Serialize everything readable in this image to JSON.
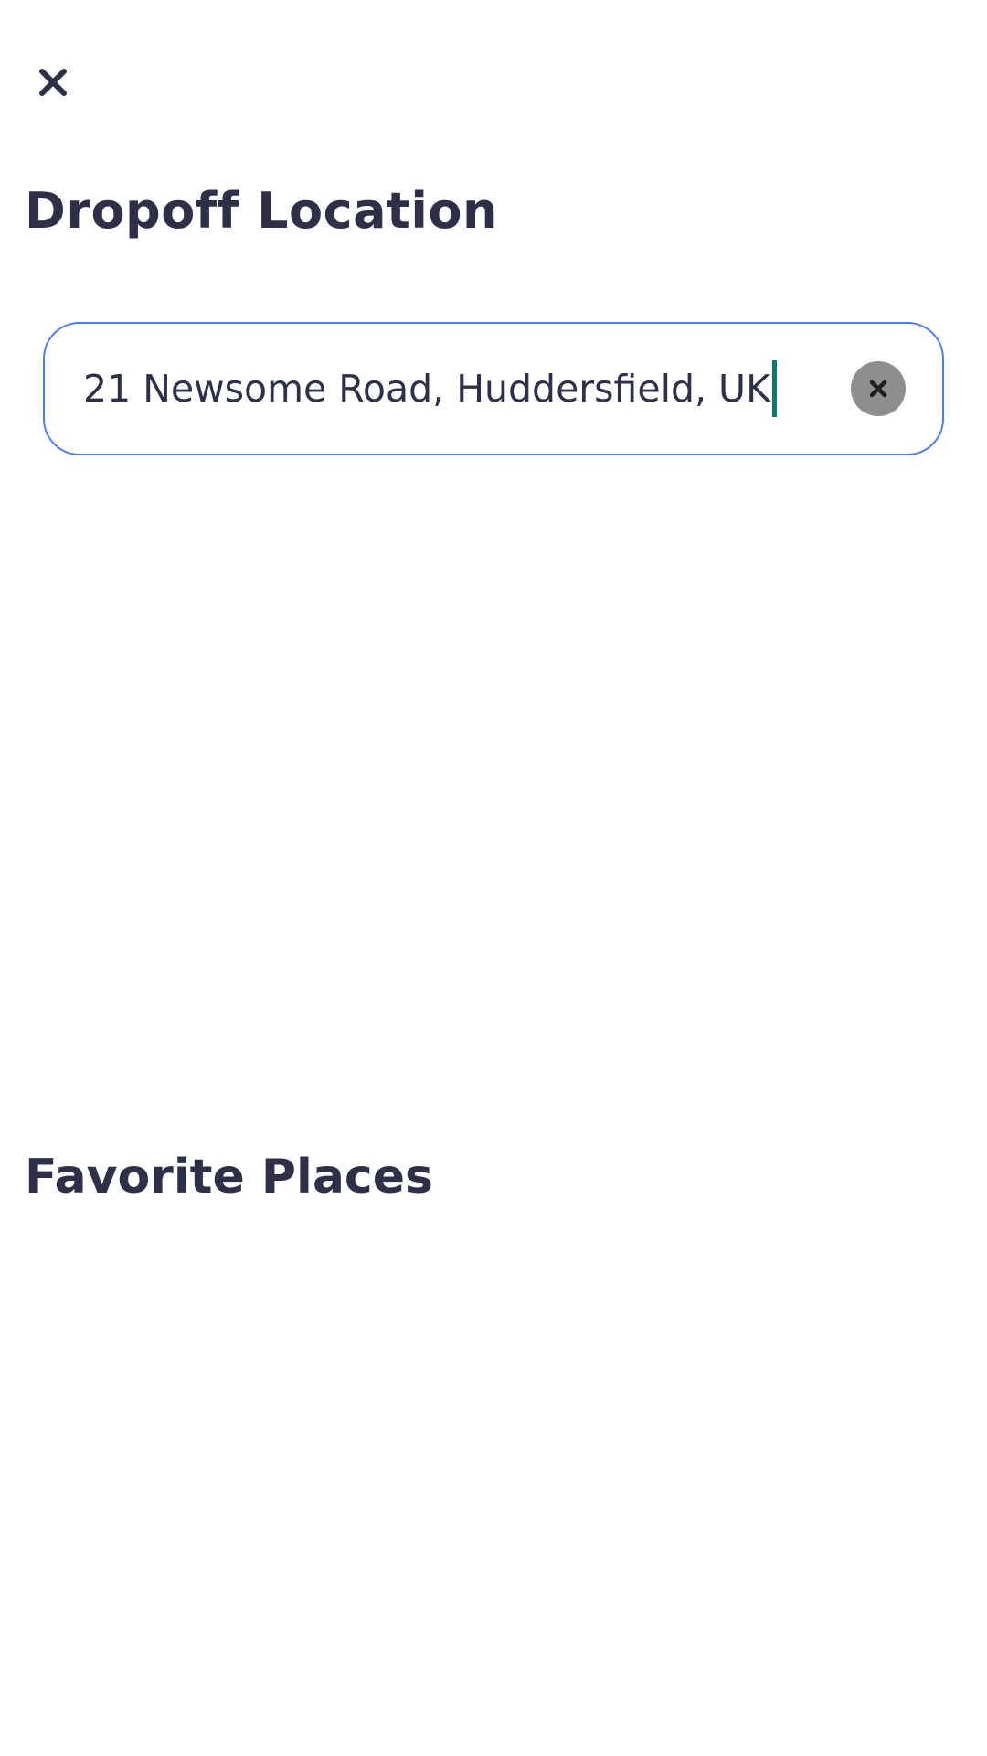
{
  "header": {
    "close_icon": "close-icon"
  },
  "page": {
    "title": "Dropoff Location"
  },
  "search": {
    "value": "21 Newsome Road, Huddersfield, UK",
    "clear_icon": "clear-circle-icon",
    "border_color": "#4f7be8",
    "caret_color": "#0f766e"
  },
  "favorites": {
    "title": "Favorite Places"
  }
}
